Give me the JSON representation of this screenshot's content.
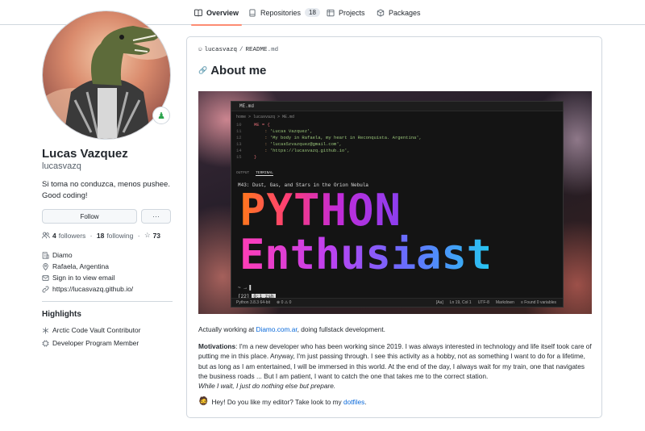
{
  "nav": {
    "tabs": [
      {
        "label": "Overview",
        "icon": "book-icon"
      },
      {
        "label": "Repositories",
        "icon": "repo-icon",
        "count": "18"
      },
      {
        "label": "Projects",
        "icon": "table-icon"
      },
      {
        "label": "Packages",
        "icon": "package-icon"
      }
    ]
  },
  "profile": {
    "fullname": "Lucas Vazquez",
    "username": "lucasvazq",
    "bio": "Si toma no conduzca, menos pushee. Good coding!",
    "follow_label": "Follow",
    "more_label": "···",
    "followers_count": "4",
    "followers_label": "followers",
    "following_count": "18",
    "following_label": "following",
    "stars_count": "73",
    "company": "Diamo",
    "location": "Rafaela, Argentina",
    "email": "Sign in to view email",
    "website": "https://lucasvazq.github.io/"
  },
  "highlights": {
    "title": "Highlights",
    "items": [
      "Arctic Code Vault Contributor",
      "Developer Program Member"
    ]
  },
  "readme": {
    "path_user": "lucasvazq",
    "path_sep": "/",
    "path_file": "README",
    "path_ext": ".md",
    "heading": "About me",
    "hero": {
      "tab": "ME.md",
      "crumb": "home > lucasvazq > ME.md",
      "lines": [
        {
          "n": "10",
          "a": "ME = {",
          "b": ""
        },
        {
          "n": "11",
          "a": "    : ",
          "b": "'Lucas Vazquez',"
        },
        {
          "n": "12",
          "a": "    : ",
          "b": "'My body in Rafaela, my heart in Reconquista. Argentina',"
        },
        {
          "n": "13",
          "a": "    : ",
          "b": "'lucas5zvazquez@gmail.com',"
        },
        {
          "n": "14",
          "a": "    : ",
          "b": "'https://lucasvazq.github.io',"
        },
        {
          "n": "15",
          "a": "}",
          "b": ""
        }
      ],
      "panel_tab_1": "OUTPUT",
      "panel_tab_2": "TERMINAL",
      "nebula": "M43: Dust, Gas, and Stars in the Orion Nebula",
      "big_1": "PYTHON",
      "big_2": "Enthusiast",
      "prompt": "~ → ▌",
      "session_num": "[22]",
      "session_zsh": "0:1 zsh",
      "status_left": [
        "Python 3.8.3 64-bit",
        "⊗ 0 ⚠ 0"
      ],
      "status_right": [
        "[Aa]",
        "Ln 19, Col 1",
        "UTF-8",
        "Markdown",
        "≡ Found 0 variables"
      ]
    },
    "work_prefix": "Actually working at ",
    "work_link": "Diamo.com.ar",
    "work_suffix": ", doing fullstack development.",
    "motivations_label": "Motivations",
    "motivations_text": ": I'm a new developer who has been working since 2019. I was always interested in technology and life itself took care of putting me in this place. Anyway, I'm just passing through. I see this activity as a hobby, not as something I want to do for a lifetime, but as long as I am entertained, I will be immersed in this world. At the end of the day, I always wait for my train, one that navigates the business roads ... But I am patient, I want to catch the one that takes me to the correct station.",
    "quote": "While I wait, I just do nothing else but prepare.",
    "editor_prefix": "Hey! Do you like my editor? Take look to my ",
    "editor_link": "dotfiles",
    "editor_suffix": "."
  },
  "colors": {
    "accent_link": "#0969da",
    "tab_underline": "#fd8c73",
    "border": "#d0d7de"
  }
}
